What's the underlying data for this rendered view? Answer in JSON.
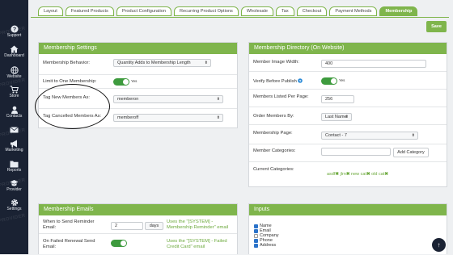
{
  "sidebar": {
    "items": [
      {
        "icon": "question-icon",
        "label": "Support"
      },
      {
        "icon": "home-icon",
        "label": "Dashboard"
      },
      {
        "icon": "globe-icon",
        "label": "Website"
      },
      {
        "icon": "cart-icon",
        "label": "Store"
      },
      {
        "icon": "person-icon",
        "label": "Contacts"
      },
      {
        "icon": "envelope-icon",
        "label": ""
      },
      {
        "icon": "megaphone-icon",
        "label": "Marketing"
      },
      {
        "icon": "folder-icon",
        "label": "Reports"
      },
      {
        "icon": "graduation-cap-icon",
        "label": "Provider"
      },
      {
        "icon": "gear-icon",
        "label": "Settings"
      }
    ],
    "watermark": "PROVIDER"
  },
  "tabs": [
    "Layout",
    "Featured Products",
    "Product Configuration",
    "Recurring Product Options",
    "Wholesale",
    "Tax",
    "Checkout",
    "Payment Methods",
    "Membership"
  ],
  "active_tab": "Membership",
  "save_label": "Save",
  "membership_settings": {
    "title": "Membership Settings",
    "behavior_label": "Membership Behavior:",
    "behavior_value": "Quantity Adds to Membership Length",
    "limit_label": "Limit to One Membership:",
    "limit_toggle": "Yes",
    "tag_new_label": "Tag New Members As:",
    "tag_new_value": "memberon",
    "tag_cancelled_label": "Tag Cancelled Members As:",
    "tag_cancelled_value": "memberoff"
  },
  "membership_directory": {
    "title": "Membership Directory (On Website)",
    "image_width_label": "Member Image Width:",
    "image_width_value": "400",
    "verify_label": "Verify Before Publish",
    "verify_toggle": "Yes",
    "listed_label": "Members Listed Per Page:",
    "listed_value": "256",
    "order_label": "Order Members By:",
    "order_value": "Last Name",
    "page_label": "Membership Page:",
    "page_value": "Contact - 7",
    "categories_label": "Member Categories:",
    "categories_value": "",
    "add_category_label": "Add Category",
    "current_label": "Current Categories:",
    "current_categories": [
      "asdf",
      "jlrn",
      "new cat",
      "old cat"
    ]
  },
  "membership_emails": {
    "title": "Membership Emails",
    "reminder_label": "When to Send Reminder Email:",
    "reminder_value": "2",
    "reminder_unit": "days",
    "reminder_note": "Uses the \"[SYSTEM] - Membership Reminder\" email",
    "failed_label": "On Failed Renewal Send Email:",
    "failed_note": "Uses the \"[SYSTEM] - Failed Credit Card\" email"
  },
  "inputs": {
    "title": "Inputs",
    "fields": [
      {
        "label": "Name",
        "checked": true
      },
      {
        "label": "Email",
        "checked": true
      },
      {
        "label": "Company",
        "checked": false
      },
      {
        "label": "Phone",
        "checked": true
      },
      {
        "label": "Address",
        "checked": true
      }
    ]
  },
  "colors": {
    "accent": "#7fb54c",
    "sidebar": "#1a2233",
    "toggle": "#3e9b3e"
  }
}
